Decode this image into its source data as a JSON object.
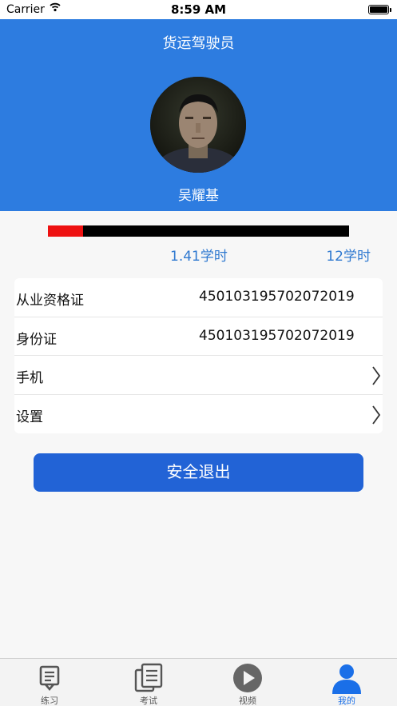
{
  "status_bar": {
    "carrier": "Carrier",
    "time": "8:59 AM"
  },
  "header": {
    "title": "货运驾驶员",
    "name": "吴耀基"
  },
  "study": {
    "progress_fraction": 0.117,
    "current_hours": "1.41学时",
    "total_hours": "12学时"
  },
  "info": [
    {
      "label": "从业资格证",
      "value": "450103195702072019"
    },
    {
      "label": "身份证",
      "value": "450103195702072019"
    },
    {
      "label": "手机",
      "value": ""
    },
    {
      "label": "设置",
      "value": ""
    }
  ],
  "logout_label": "安全退出",
  "tabs": [
    {
      "label": "练习",
      "icon": "practice-icon"
    },
    {
      "label": "考试",
      "icon": "exam-icon"
    },
    {
      "label": "视频",
      "icon": "video-icon"
    },
    {
      "label": "我的",
      "icon": "profile-icon",
      "active": true
    }
  ],
  "colors": {
    "header": "#2d7ce0",
    "accent": "#2263d6",
    "progress_fill": "#ee1111",
    "tab_active": "#1a6fe8"
  }
}
